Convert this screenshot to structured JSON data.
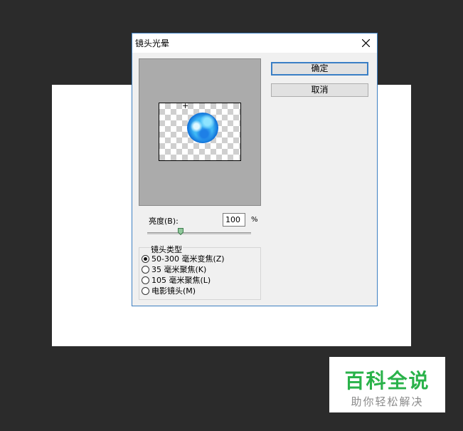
{
  "dialog": {
    "title": "镜头光晕",
    "ok_label": "确定",
    "cancel_label": "取消",
    "brightness_label": "亮度(B):",
    "brightness_value": "100",
    "brightness_unit": "%",
    "brightness_slider_fraction": 0.33,
    "preview_crosshair": "+",
    "lens_type_label": "镜头类型",
    "lens_options": [
      {
        "label": "50-300 毫米变焦(Z)",
        "selected": true
      },
      {
        "label": "35 毫米聚焦(K)",
        "selected": false
      },
      {
        "label": "105 毫米聚焦(L)",
        "selected": false
      },
      {
        "label": "电影镜头(M)",
        "selected": false
      }
    ]
  },
  "icons": {
    "close": "close-icon",
    "slider_thumb": "slider-thumb-icon",
    "radio": "radio-button"
  },
  "watermark": {
    "title": "百科全说",
    "subtitle": "助你轻松解决"
  },
  "colors": {
    "workspace_bg": "#2b2b2b",
    "dialog_bg": "#f0f0f0",
    "accent_border": "#3a7fc5",
    "watermark_green": "#2ab24a"
  }
}
